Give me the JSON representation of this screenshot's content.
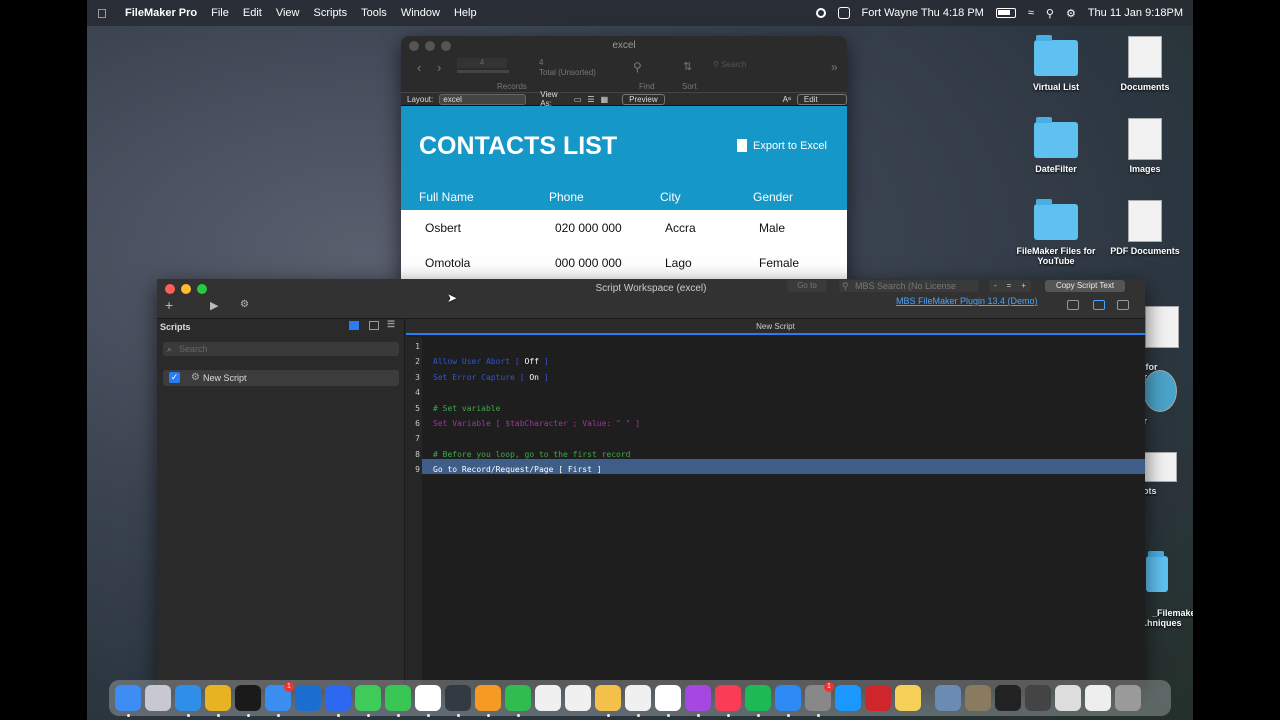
{
  "menubar": {
    "app_name": "FileMaker Pro",
    "menus": [
      "File",
      "Edit",
      "View",
      "Scripts",
      "Tools",
      "Window",
      "Help"
    ],
    "location_time": "Fort Wayne Thu 4:18 PM",
    "datetime": "Thu 11 Jan  9:18PM"
  },
  "desktop": {
    "icons": [
      {
        "label": "Virtual List",
        "type": "folder"
      },
      {
        "label": "Documents",
        "type": "doc"
      },
      {
        "label": "DateFilter",
        "type": "folder"
      },
      {
        "label": "Images",
        "type": "doc"
      },
      {
        "label": "FileMaker Files for YouTube",
        "type": "folder"
      },
      {
        "label": "PDF Documents",
        "type": "doc"
      },
      {
        "label": "et for\nmber",
        "type": "doc"
      },
      {
        "label": "her",
        "type": "doc"
      },
      {
        "label": "nshots",
        "type": "doc"
      },
      {
        "label": "_Filemake\n..hniques",
        "type": "folder"
      }
    ]
  },
  "fm_window": {
    "title": "excel",
    "record_number": "4",
    "total": "Total (Unsorted)",
    "records_label": "Records",
    "find_label": "Find",
    "sort_label": "Sort",
    "search_placeholder": "Search",
    "layout_label": "Layout:",
    "layout_value": "excel",
    "view_as_label": "View As:",
    "preview_label": "Preview",
    "edit_layout_label": "Edit Layout",
    "header_title": "CONTACTS LIST",
    "export_label": "Export to Excel",
    "columns": [
      "Full Name",
      "Phone",
      "City",
      "Gender"
    ],
    "rows": [
      [
        "Osbert",
        "020 000 000",
        "Accra",
        "Male"
      ],
      [
        "Omotola",
        "000 000 000",
        "Lago",
        "Female"
      ]
    ]
  },
  "script_workspace": {
    "title": "Script Workspace (excel)",
    "goto_placeholder": "Go to",
    "mbs_search_placeholder": "MBS Search (No License",
    "step_controls": [
      "-",
      "=",
      "+"
    ],
    "copy_label": "Copy Script Text",
    "plugin_link": "MBS FileMaker Plugin 13.4 (Demo)",
    "scripts_header": "Scripts",
    "search_placeholder": "Search",
    "script_name": "New Script",
    "tab_name": "New Script",
    "lines": [
      {
        "num": "1",
        "kind": "blank",
        "text": ""
      },
      {
        "num": "2",
        "kind": "step",
        "keyword": "Allow User Abort [ ",
        "value": "Off",
        "tail": " ]"
      },
      {
        "num": "3",
        "kind": "step",
        "keyword": "Set Error Capture [ ",
        "value": "On",
        "tail": " ]"
      },
      {
        "num": "4",
        "kind": "blank",
        "text": ""
      },
      {
        "num": "5",
        "kind": "comment",
        "text": "# Set variable"
      },
      {
        "num": "6",
        "kind": "var",
        "text": "Set Variable [ $tabCharacter ; Value: \" \" ]"
      },
      {
        "num": "7",
        "kind": "blank",
        "text": ""
      },
      {
        "num": "8",
        "kind": "comment",
        "text": "# Before you loop, go to the first record"
      },
      {
        "num": "9",
        "kind": "selected",
        "text": "Go to Record/Request/Page [ First ]"
      }
    ]
  },
  "dock": {
    "apps": [
      {
        "name": "finder-icon",
        "color": "#3d8df5",
        "badge": ""
      },
      {
        "name": "launchpad-icon",
        "color": "#c8c8d0",
        "badge": ""
      },
      {
        "name": "safari-icon",
        "color": "#2f8fe8",
        "badge": ""
      },
      {
        "name": "chrome-icon",
        "color": "#e8b322",
        "badge": ""
      },
      {
        "name": "filemaker-icon",
        "color": "#1a1a1a",
        "badge": ""
      },
      {
        "name": "mail-icon",
        "color": "#3a8ef0",
        "badge": "1"
      },
      {
        "name": "trello-icon",
        "color": "#1a6fd0",
        "badge": ""
      },
      {
        "name": "zoom-icon",
        "color": "#2d68f0",
        "badge": ""
      },
      {
        "name": "messages-icon",
        "color": "#3ecb5a",
        "badge": ""
      },
      {
        "name": "facetime-icon",
        "color": "#3ac653",
        "badge": ""
      },
      {
        "name": "slack-icon",
        "color": "#ffffff",
        "badge": ""
      },
      {
        "name": "quicktime-icon",
        "color": "#333a44",
        "badge": ""
      },
      {
        "name": "pages-icon",
        "color": "#f59a23",
        "badge": ""
      },
      {
        "name": "numbers-icon",
        "color": "#2fbd4f",
        "badge": ""
      },
      {
        "name": "drive-icon",
        "color": "#f0f0f0",
        "badge": ""
      },
      {
        "name": "freeform-icon",
        "color": "#f0f0f0",
        "badge": ""
      },
      {
        "name": "photos-icon",
        "color": "#f5c04a",
        "badge": ""
      },
      {
        "name": "notes-icon",
        "color": "#f0f0f0",
        "badge": ""
      },
      {
        "name": "calendar-icon",
        "color": "#ffffff",
        "badge": ""
      },
      {
        "name": "podcasts-icon",
        "color": "#a547e0",
        "badge": ""
      },
      {
        "name": "music-icon",
        "color": "#fa3c55",
        "badge": ""
      },
      {
        "name": "spotify-icon",
        "color": "#1db954",
        "badge": ""
      },
      {
        "name": "appstore-icon",
        "color": "#2f8af5",
        "badge": ""
      },
      {
        "name": "settings-icon",
        "color": "#888888",
        "badge": "1"
      },
      {
        "name": "primevideo-icon",
        "color": "#1a98ff",
        "badge": ""
      },
      {
        "name": "pdf-icon",
        "color": "#d0252a",
        "badge": ""
      },
      {
        "name": "notepad-icon",
        "color": "#f5d15a",
        "badge": ""
      },
      {
        "name": "preview-icon",
        "color": "#6b8bb5",
        "badge": ""
      },
      {
        "name": "thumb-1-icon",
        "color": "#8a7a60",
        "badge": ""
      },
      {
        "name": "thumb-2-icon",
        "color": "#222222",
        "badge": ""
      },
      {
        "name": "thumb-3-icon",
        "color": "#444444",
        "badge": ""
      },
      {
        "name": "thumb-4-icon",
        "color": "#dddddd",
        "badge": ""
      },
      {
        "name": "thumb-5-icon",
        "color": "#eeeeee",
        "badge": ""
      },
      {
        "name": "trash-icon",
        "color": "#9a9a9a",
        "badge": ""
      }
    ]
  }
}
